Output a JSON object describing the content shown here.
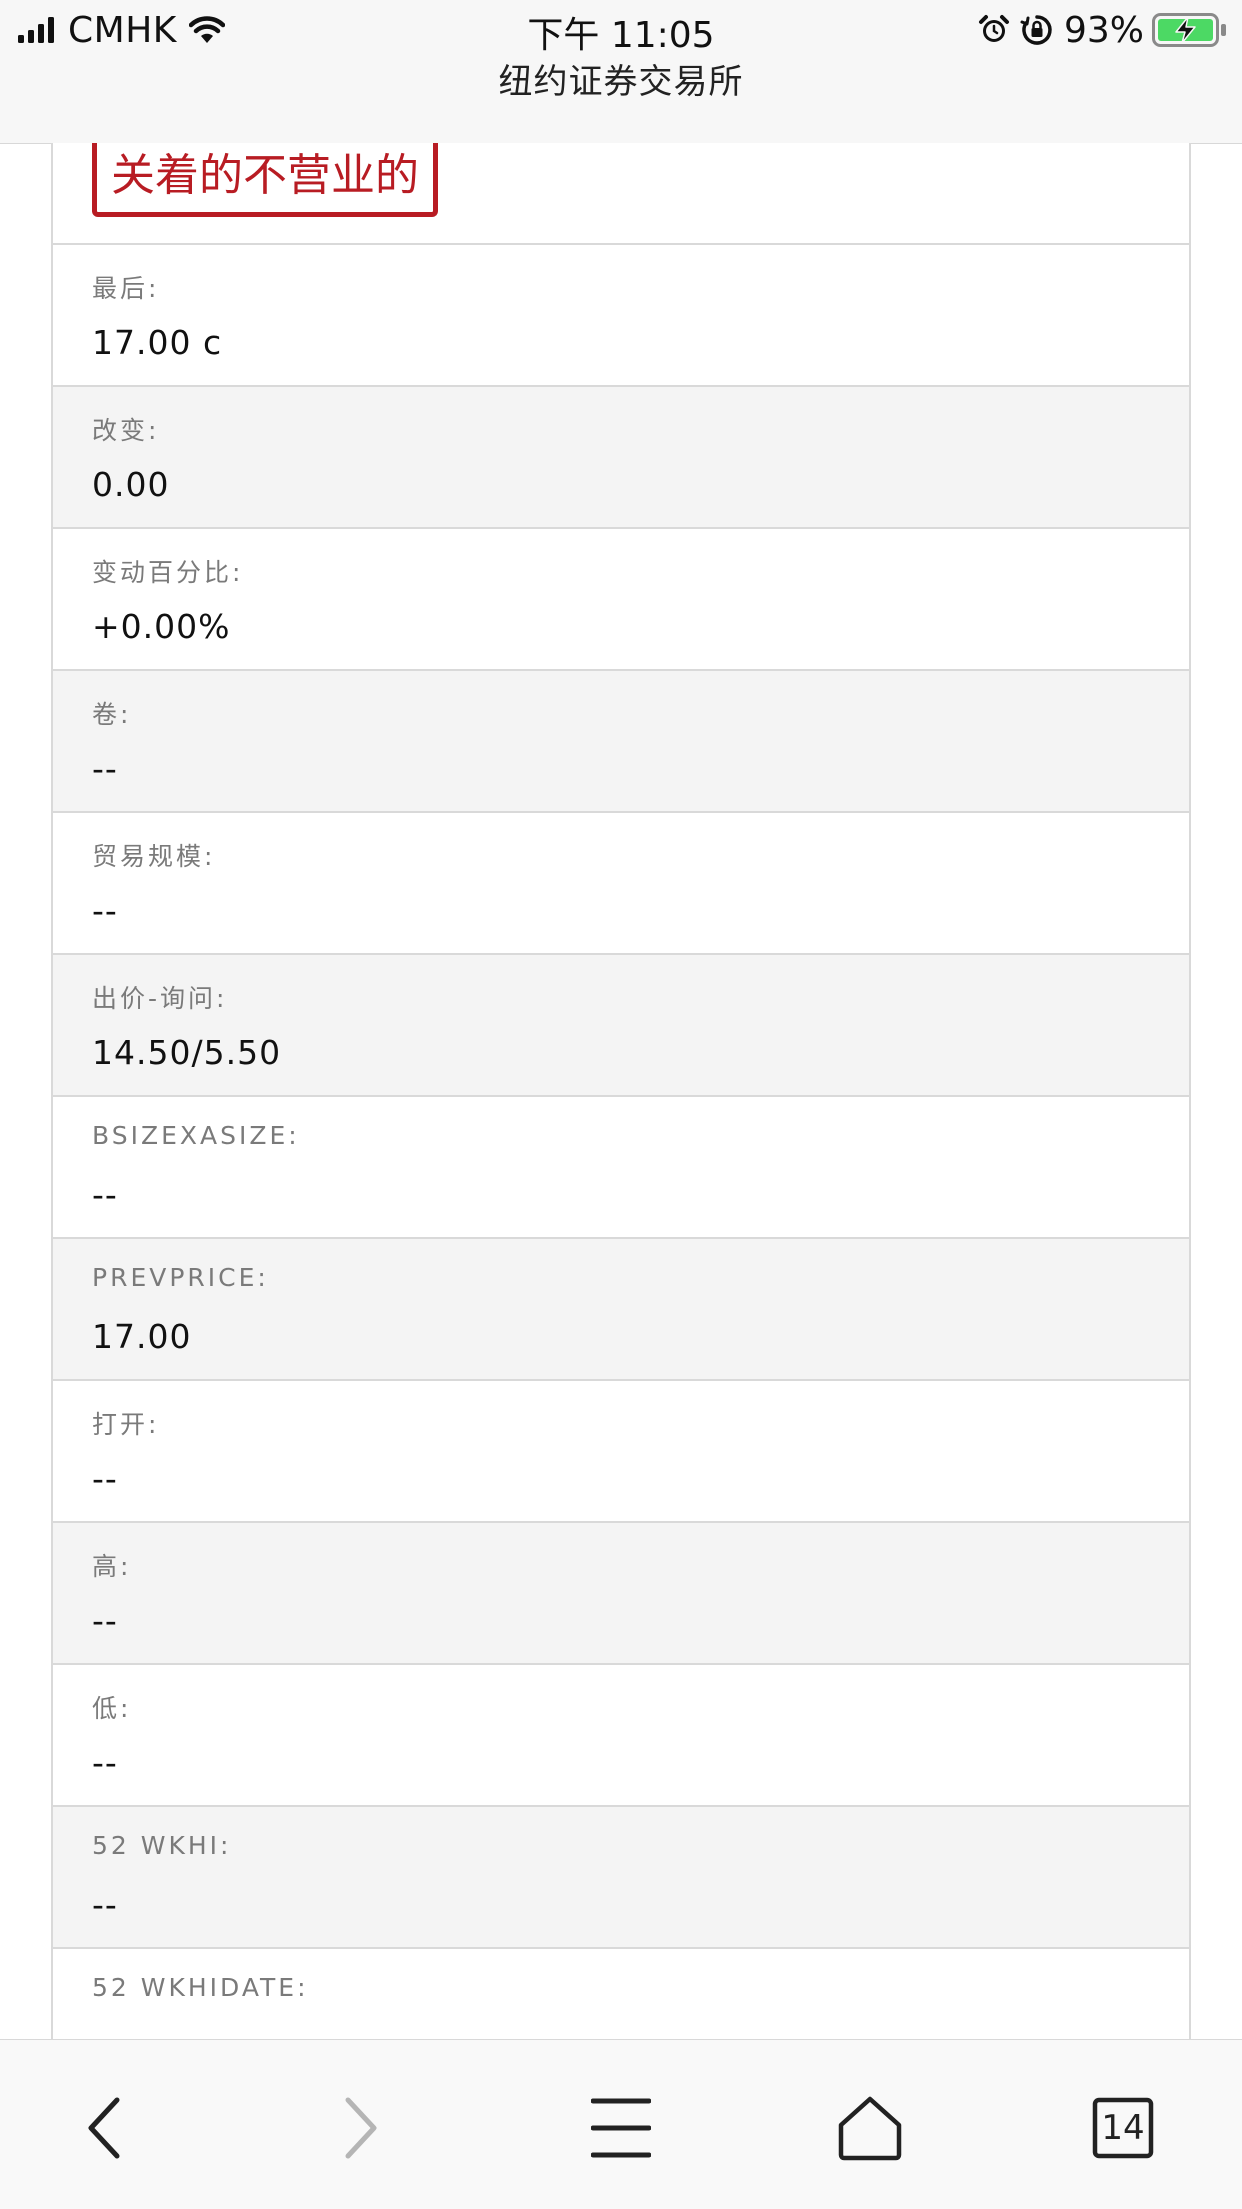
{
  "status_bar": {
    "carrier": "CMHK",
    "time": "下午 11:05",
    "battery": "93%",
    "icons": [
      "signal-icon",
      "wifi-icon",
      "alarm-icon",
      "rotation-lock-icon",
      "battery-charging-icon"
    ],
    "battery_color": "#4cd964"
  },
  "page": {
    "title": "纽约证券交易所"
  },
  "market_status": {
    "text": "关着的不营业的",
    "color": "#b81c23"
  },
  "quote_rows": [
    {
      "label": "最后:",
      "value": "17.00 c"
    },
    {
      "label": "改变:",
      "value": "0.00"
    },
    {
      "label": "变动百分比:",
      "value": "+0.00%"
    },
    {
      "label": "卷:",
      "value": "--"
    },
    {
      "label": "贸易规模:",
      "value": "--"
    },
    {
      "label": "出价-询问:",
      "value": "14.50/5.50"
    },
    {
      "label": "BSIZEXASIZE:",
      "value": "--"
    },
    {
      "label": "PREVPRICE:",
      "value": "17.00"
    },
    {
      "label": "打开:",
      "value": "--"
    },
    {
      "label": "高:",
      "value": "--"
    },
    {
      "label": "低:",
      "value": "--"
    },
    {
      "label": "52 WKHI:",
      "value": "--"
    },
    {
      "label": "52 WKHIDATE:",
      "value": ""
    }
  ],
  "toolbar": {
    "icons": [
      "back-icon",
      "forward-icon",
      "menu-icon",
      "home-icon",
      "tabs-icon"
    ],
    "tabs_count": "14"
  }
}
